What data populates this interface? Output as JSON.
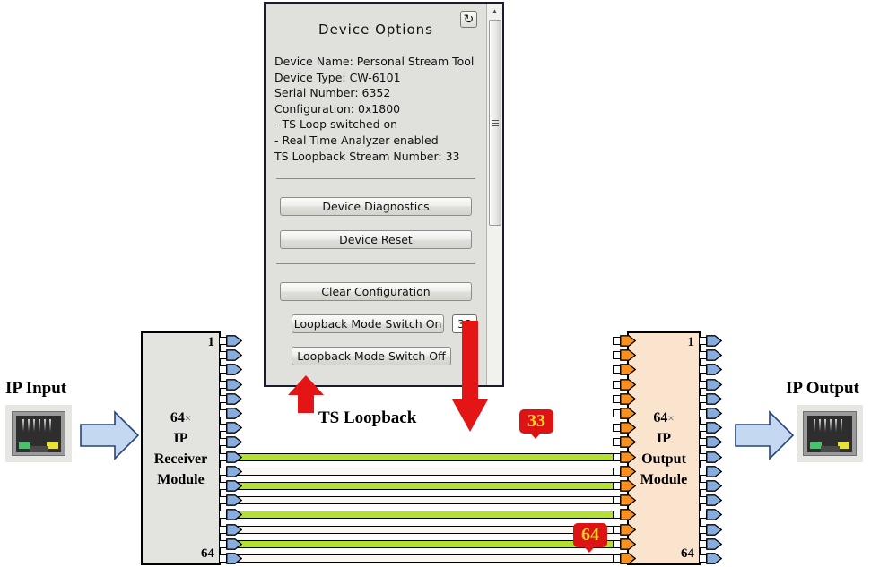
{
  "dialog": {
    "title": "Device Options",
    "refresh_icon": "refresh-icon",
    "info_lines": [
      "Device Name: Personal Stream Tool",
      "Device Type: CW-6101",
      "Serial Number: 6352",
      "Configuration: 0x1800",
      "- TS Loop switched on",
      "- Real Time Analyzer enabled",
      "TS Loopback Stream Number: 33"
    ],
    "buttons": {
      "diagnostics": "Device Diagnostics",
      "reset": "Device Reset",
      "clear_configuration": "Clear Configuration",
      "loopback_on": "Loopback Mode Switch On",
      "loopback_off": "Loopback Mode Switch Off"
    },
    "stream_number_value": "33",
    "scrollbar": {
      "up_arrow_icon": "scroll-up-arrow-icon",
      "grip_icon": "scroll-grip-icon"
    }
  },
  "diagram": {
    "input_label": "IP Input",
    "output_label": "IP Output",
    "input_icon": "rj45-ethernet-jack-icon",
    "output_icon": "rj45-ethernet-jack-icon",
    "flow_arrow_in_icon": "right-arrow-icon",
    "flow_arrow_out_icon": "right-arrow-icon",
    "receiver_module": {
      "count": "64",
      "multiplier": "×",
      "line2": "IP",
      "line3": "Receiver",
      "line4": "Module",
      "pin_first": "1",
      "pin_last": "64"
    },
    "output_module": {
      "count": "64",
      "multiplier": "×",
      "line2": "IP",
      "line3": "Output",
      "line4": "Module",
      "pin_first": "1",
      "pin_last": "64"
    },
    "loopback_label": "TS Loopback",
    "badges": [
      {
        "name": "stream-badge-33",
        "value": "33"
      },
      {
        "name": "stream-badge-64",
        "value": "64"
      }
    ],
    "callout_arrow_up_icon": "red-up-arrow-icon",
    "callout_arrow_down_icon": "red-down-arrow-icon"
  },
  "colors": {
    "link_active": "#b3e032",
    "link_inactive": "#fbf8f3",
    "badge_bg": "#dd1414",
    "badge_text": "#f5d22a",
    "receiver_fill": "#e3e3df",
    "output_fill": "#fbe4cd",
    "pin_blue": "#87acde",
    "pin_orange": "#f79020",
    "flow_arrow": "#c5d8f2",
    "dialog_bg": "#e0e0dc"
  }
}
